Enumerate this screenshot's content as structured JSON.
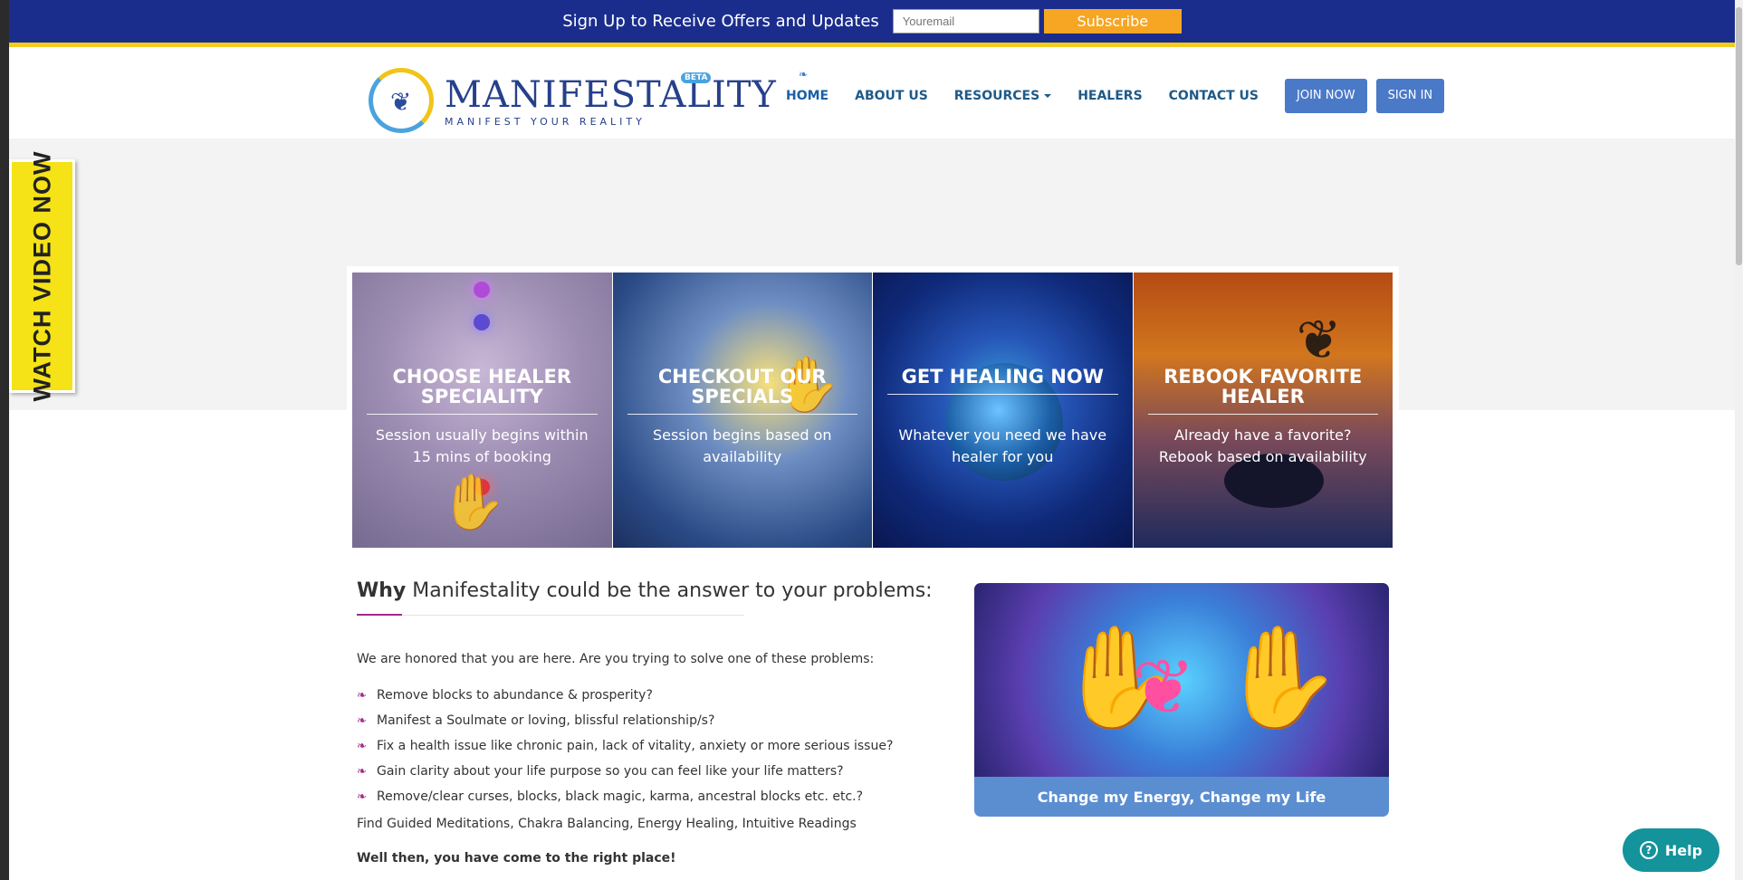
{
  "topbar": {
    "signup_text": "Sign Up to Receive Offers and Updates",
    "email_placeholder": "Youremail",
    "subscribe_label": "Subscribe"
  },
  "logo": {
    "name": "MANIFESTALITY",
    "tagline": "MANIFEST YOUR REALITY",
    "badge": "BETA"
  },
  "nav": {
    "items": [
      "HOME",
      "ABOUT US",
      "RESOURCES",
      "HEALERS",
      "CONTACT US"
    ],
    "join_label": "JOIN NOW",
    "signin_label": "SIGN IN"
  },
  "watch_video": "WATCH VIDEO NOW",
  "cards": [
    {
      "title": "CHOOSE HEALER SPECIALITY",
      "desc": "Session usually begins within 15 mins of booking"
    },
    {
      "title": "CHECKOUT OUR SPECIALS",
      "desc": "Session begins based on availability"
    },
    {
      "title": "GET HEALING NOW",
      "desc": "Whatever you need we have healer for you"
    },
    {
      "title": "REBOOK FAVORITE HEALER",
      "desc": "Already have a favorite? Rebook based on availability"
    }
  ],
  "why": {
    "bold": "Why",
    "rest": " Manifestality could be the answer to your problems:",
    "intro": "We are honored that you are here. Are you trying to solve one of these problems:",
    "items": [
      "Remove blocks to abundance & prosperity?",
      "Manifest a Soulmate or loving, blissful relationship/s?",
      "Fix a health issue like chronic pain, lack of vitality, anxiety or more serious issue?",
      "Gain clarity about your life purpose so you can feel like your life matters?",
      "Remove/clear curses, blocks, black magic, karma, ancestral blocks etc. etc.?"
    ],
    "find": "Find Guided Meditations, Chakra Balancing, Energy Healing, Intuitive Readings",
    "right_place": "Well then, you have come to the right place!"
  },
  "image_card": {
    "caption": "Change my Energy, Change my Life"
  },
  "help_label": "Help",
  "colors": {
    "topbar": "#1b2d8c",
    "accent_yellow": "#f3cb1b",
    "subscribe": "#f6a623",
    "nav_text": "#1e5a88",
    "button_blue": "#4a79c8",
    "bullet_purple": "#a32a8a",
    "help": "#14939b"
  },
  "icons": {
    "nav_home": "butterfly-icon",
    "list_bullet": "butterfly-bullet-icon",
    "help": "question-circle-icon"
  }
}
